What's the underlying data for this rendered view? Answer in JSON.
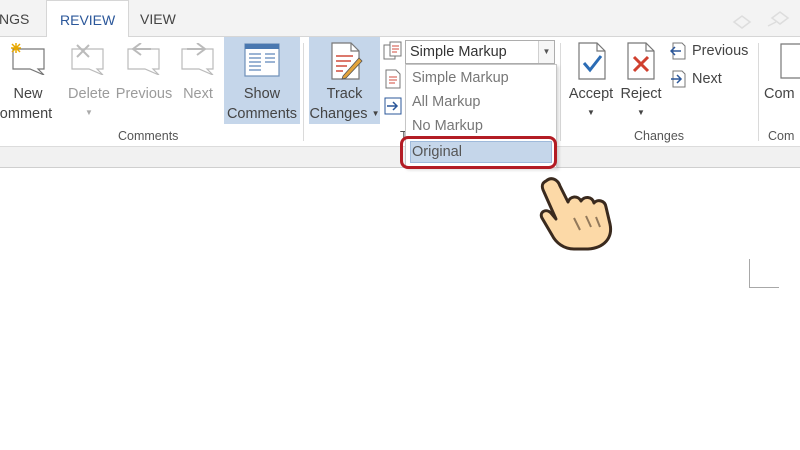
{
  "tabs": [
    {
      "label": "NGS",
      "active": false
    },
    {
      "label": "REVIEW",
      "active": true
    },
    {
      "label": "VIEW",
      "active": false
    }
  ],
  "comments_group": {
    "label": "Comments",
    "new_line1": "New",
    "new_line2": "omment",
    "delete": "Delete",
    "previous": "Previous",
    "next": "Next",
    "show_line1": "Show",
    "show_line2": "Comments"
  },
  "tracking_group": {
    "label": "T",
    "track_line1": "Track",
    "track_line2": "Changes",
    "display_value": "Simple Markup",
    "options": [
      "Simple Markup",
      "All Markup",
      "No Markup",
      "Original"
    ],
    "highlighted_option": "Original"
  },
  "changes_group": {
    "label": "Changes",
    "accept": "Accept",
    "reject": "Reject",
    "previous": "Previous",
    "next": "Next"
  },
  "compare_group": {
    "label": "Com",
    "button": "Com"
  },
  "colors": {
    "accent": "#2b579a",
    "highlight": "#c5d6ea",
    "callout_ring": "#b31c24",
    "hand_fill": "#fcd9a7"
  },
  "icons": [
    "new-comment-icon",
    "delete-comment-icon",
    "previous-comment-icon",
    "next-comment-icon",
    "show-comments-icon",
    "track-changes-icon",
    "display-for-review-icon",
    "show-markup-icon",
    "reviewing-pane-icon",
    "accept-icon",
    "reject-icon",
    "previous-change-icon",
    "next-change-icon",
    "pointing-hand-icon"
  ]
}
